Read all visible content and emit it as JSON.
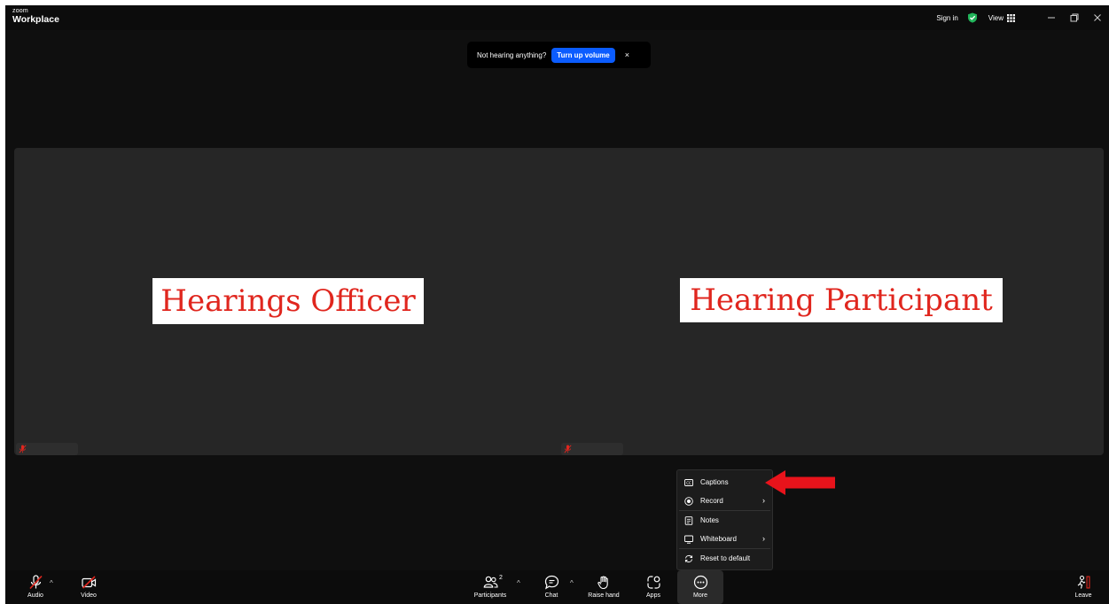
{
  "titlebar": {
    "logo_top": "zoom",
    "logo_bottom": "Workplace",
    "sign_in": "Sign in",
    "view": "View",
    "shield_color": "#21b45a",
    "window_controls": [
      "minimize-icon",
      "restore-icon",
      "close-icon"
    ]
  },
  "notification": {
    "text": "Not hearing anything?",
    "button": "Turn up volume",
    "close": "×",
    "button_color": "#0b5cff"
  },
  "tiles": [
    {
      "label": "Hearings Officer",
      "muted": true
    },
    {
      "label": "Hearing Participant",
      "muted": true
    }
  ],
  "more_menu": {
    "items": [
      {
        "label": "Captions",
        "icon": "captions-icon",
        "submenu": false
      },
      {
        "label": "Record",
        "icon": "record-icon",
        "submenu": true
      },
      {
        "label": "Notes",
        "icon": "notes-icon",
        "submenu": false
      },
      {
        "label": "Whiteboard",
        "icon": "whiteboard-icon",
        "submenu": true
      },
      {
        "label": "Reset to default",
        "icon": "reset-icon",
        "submenu": false
      }
    ],
    "submenu_chevron": "›"
  },
  "toolbar": {
    "audio": "Audio",
    "video": "Video",
    "participants": "Participants",
    "participants_count": "2",
    "chat": "Chat",
    "raise_hand": "Raise hand",
    "apps": "Apps",
    "more": "More",
    "leave": "Leave",
    "caret": "^",
    "mute_color": "#e0261e"
  },
  "annotations": {
    "arrow_color": "#e8131b"
  }
}
